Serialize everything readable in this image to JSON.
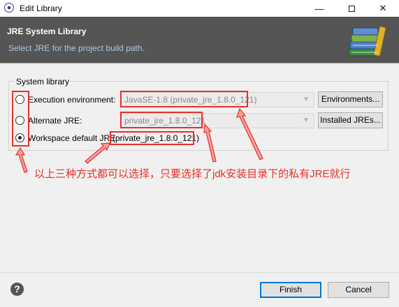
{
  "window": {
    "title": "Edit Library",
    "minimize_glyph": "—",
    "close_glyph": "✕"
  },
  "header": {
    "title": "JRE System Library",
    "description": "Select JRE for the project build path."
  },
  "system_library": {
    "group_label": "System library",
    "execution_env": {
      "label": "Execution environment:",
      "value": "JavaSE-1.8 (private_jre_1.8.0_121)",
      "button": "Environments...",
      "selected": false
    },
    "alternate_jre": {
      "label": "Alternate JRE:",
      "value": "private_jre_1.8.0_121",
      "button": "Installed JREs...",
      "selected": false
    },
    "workspace_default": {
      "label": "Workspace default JRE",
      "value": "(private_jre_1.8.0_121)",
      "selected": true
    }
  },
  "annotation": {
    "text": "以上三种方式都可以选择，只要选择了jdk安装目录下的私有JRE就行",
    "color": "#e8302a"
  },
  "footer": {
    "help_glyph": "?",
    "finish_label": "Finish",
    "cancel_label": "Cancel"
  },
  "colors": {
    "header_bg": "#555555",
    "header_desc": "#a9c9e7",
    "dialog_bg": "#f0f0f0",
    "annotation_red": "#e8302a",
    "default_button_border": "#0078d7"
  },
  "icons": {
    "app": "eclipse-icon",
    "header_art": "library-books-icon",
    "help": "help-icon"
  }
}
